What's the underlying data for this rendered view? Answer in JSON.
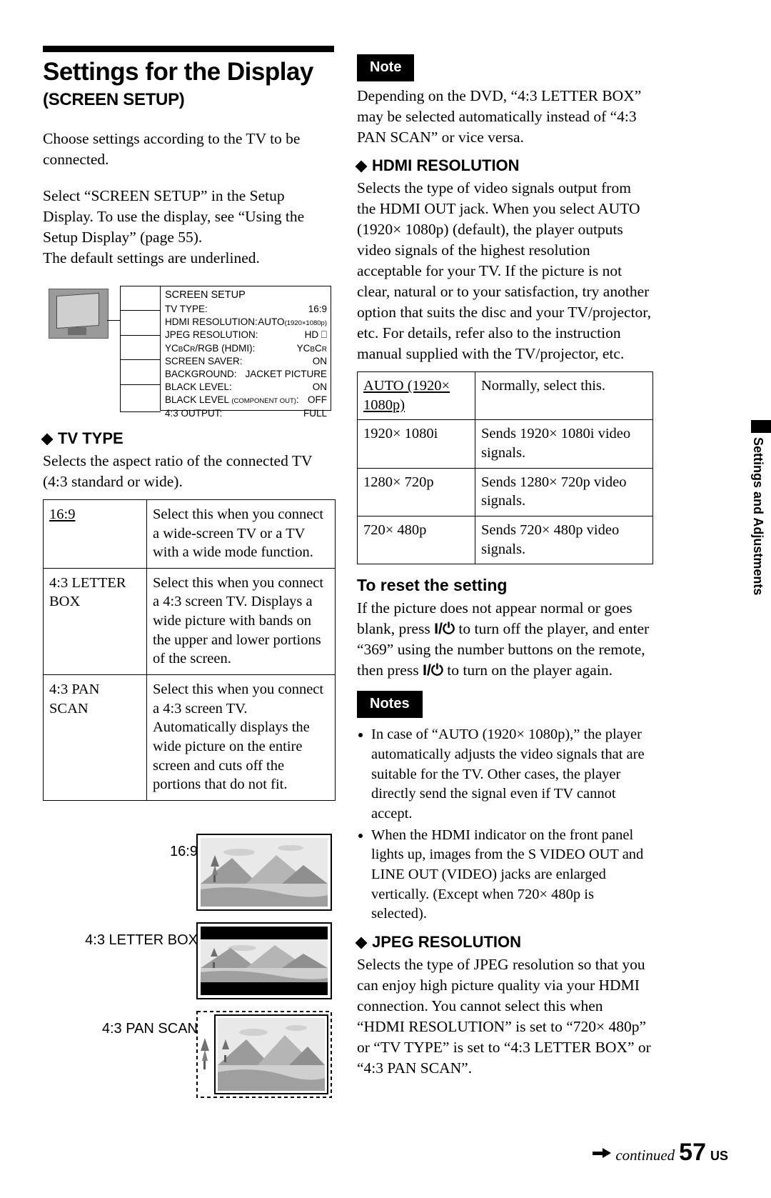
{
  "left": {
    "title": "Settings for the Display",
    "subtitle": "(SCREEN SETUP)",
    "intro1": "Choose settings according to the TV to be connected.",
    "intro2": "Select “SCREEN SETUP” in the Setup Display. To use the display, see “Using the Setup Display” (page 55).",
    "intro3": "The default settings are underlined.",
    "setup_display": {
      "title": "SCREEN SETUP",
      "rows": [
        {
          "label": "TV TYPE:",
          "value": "16:9",
          "value_sub": ""
        },
        {
          "label": "HDMI RESOLUTION:",
          "value": "AUTO",
          "value_sub": "(1920×1080p)"
        },
        {
          "label": "JPEG RESOLUTION:",
          "value": "HD ⎕",
          "value_sub": ""
        },
        {
          "label": "YCBCR/RGB (HDMI):",
          "value": "YCBCR",
          "value_sub": ""
        },
        {
          "label": "SCREEN SAVER:",
          "value": "ON",
          "value_sub": ""
        },
        {
          "label": "BACKGROUND:",
          "value": "JACKET PICTURE",
          "value_sub": ""
        },
        {
          "label": "BLACK LEVEL:",
          "value": "ON",
          "value_sub": ""
        },
        {
          "label": "BLACK LEVEL (COMPONENT OUT):",
          "value": "OFF",
          "value_sub": ""
        },
        {
          "label": "4:3 OUTPUT:",
          "value": "FULL",
          "value_sub": ""
        }
      ]
    },
    "tv_type": {
      "heading": "TV TYPE",
      "desc": "Selects the aspect ratio of the connected TV (4:3 standard or wide).",
      "rows": [
        {
          "key": "16:9",
          "key_underlined": true,
          "desc": "Select this when you connect a wide-screen TV or a TV with a wide mode function."
        },
        {
          "key": "4:3 LETTER BOX",
          "key_underlined": false,
          "desc": "Select this when you connect a 4:3 screen TV. Displays a wide picture with bands on the upper and lower portions of the screen."
        },
        {
          "key": "4:3 PAN SCAN",
          "key_underlined": false,
          "desc": "Select this when you connect a 4:3 screen TV. Automatically displays the wide picture on the entire screen and cuts off the portions that do not fit."
        }
      ]
    },
    "samples": [
      {
        "label": "16:9"
      },
      {
        "label": "4:3 LETTER BOX"
      },
      {
        "label": "4:3 PAN SCAN"
      }
    ]
  },
  "right": {
    "note_label": "Note",
    "note_text": "Depending on the DVD, “4:3 LETTER BOX” may be selected automatically instead of “4:3 PAN SCAN” or vice versa.",
    "hdmi": {
      "heading": "HDMI RESOLUTION",
      "desc": "Selects the type of video signals output from the HDMI OUT jack. When you select AUTO (1920× 1080p) (default), the player outputs video signals of the highest resolution acceptable for your TV. If the picture is not clear, natural or to your satisfaction, try another option that suits the disc and your TV/projector, etc. For details, refer also to the instruction manual supplied with the TV/projector, etc.",
      "rows": [
        {
          "key": "AUTO (1920× 1080p)",
          "key_underlined": true,
          "desc": "Normally, select this."
        },
        {
          "key": "1920× 1080i",
          "key_underlined": false,
          "desc": "Sends 1920× 1080i video signals."
        },
        {
          "key": "1280× 720p",
          "key_underlined": false,
          "desc": "Sends 1280× 720p video signals."
        },
        {
          "key": "720× 480p",
          "key_underlined": false,
          "desc": "Sends 720× 480p video signals."
        }
      ]
    },
    "reset": {
      "heading": "To reset the setting",
      "text_a": "If the picture does not appear normal or goes blank, press ",
      "text_b": " to turn off the player, and enter “369” using the number buttons on the remote, then press ",
      "text_c": " to turn on the player again.",
      "power_symbol": "I/⏻"
    },
    "notes_label": "Notes",
    "notes": [
      "In case of “AUTO (1920× 1080p),” the player automatically adjusts the video signals that are suitable for the TV.\nOther cases, the player directly send the signal even if TV cannot accept.",
      "When the HDMI indicator on the front panel lights up, images from the S VIDEO OUT and LINE OUT (VIDEO) jacks are enlarged vertically. (Except when 720× 480p is selected)."
    ],
    "jpeg": {
      "heading": "JPEG RESOLUTION",
      "desc": "Selects the type of JPEG resolution so that you can enjoy high picture quality via your HDMI connection.\nYou cannot select this when “HDMI RESOLUTION” is set to “720× 480p” or “TV TYPE” is set to “4:3 LETTER BOX” or “4:3 PAN SCAN”."
    }
  },
  "side_tab_text": "Settings and Adjustments",
  "footer": {
    "continued": "continued",
    "page": "57",
    "region": "US"
  }
}
